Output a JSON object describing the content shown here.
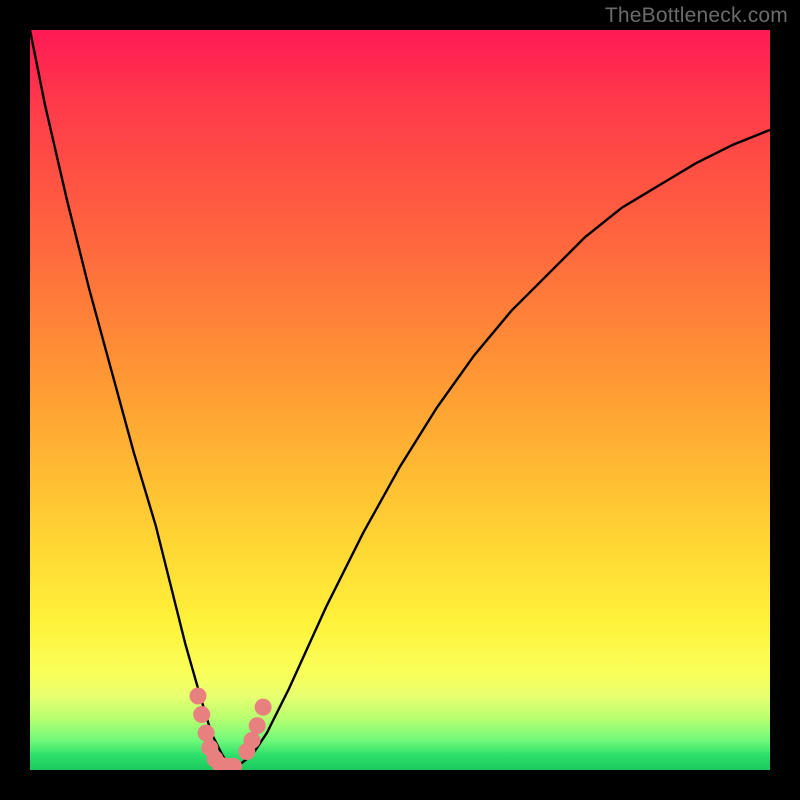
{
  "watermark": "TheBottleneck.com",
  "colors": {
    "frame": "#000000",
    "gradient_top": "#ff1a55",
    "gradient_mid": "#ffd233",
    "gradient_bottom": "#1cc85f",
    "curve": "#000000",
    "marker": "#e98080"
  },
  "chart_data": {
    "type": "line",
    "title": "",
    "xlabel": "",
    "ylabel": "",
    "xlim": [
      0,
      100
    ],
    "ylim": [
      0,
      100
    ],
    "x": [
      0,
      2,
      5,
      8,
      11,
      14,
      17,
      19,
      21,
      23,
      24.5,
      26,
      27,
      28,
      30,
      32,
      35,
      40,
      45,
      50,
      55,
      60,
      65,
      70,
      75,
      80,
      85,
      90,
      95,
      100
    ],
    "values": [
      100,
      90,
      77,
      65,
      54,
      43,
      33,
      25,
      17,
      10,
      5,
      2,
      0.5,
      0.5,
      2,
      5,
      11,
      22,
      32,
      41,
      49,
      56,
      62,
      67,
      72,
      76,
      79,
      82,
      84.5,
      86.5
    ],
    "valley_x_range": [
      23,
      30
    ],
    "markers": [
      {
        "x": 22.7,
        "y": 10
      },
      {
        "x": 23.2,
        "y": 7.5
      },
      {
        "x": 23.8,
        "y": 5
      },
      {
        "x": 24.3,
        "y": 3
      },
      {
        "x": 25,
        "y": 1.5
      },
      {
        "x": 25.7,
        "y": 0.7
      },
      {
        "x": 26.5,
        "y": 0.5
      },
      {
        "x": 27.5,
        "y": 0.5
      },
      {
        "x": 29.3,
        "y": 2.5
      },
      {
        "x": 30,
        "y": 4
      },
      {
        "x": 30.7,
        "y": 6
      },
      {
        "x": 31.5,
        "y": 8.5
      }
    ],
    "notes": "V-shaped bottleneck curve on vertical red→green gradient; pink markers cluster at the valley near x≈23–31; no visible axes or tick labels."
  }
}
